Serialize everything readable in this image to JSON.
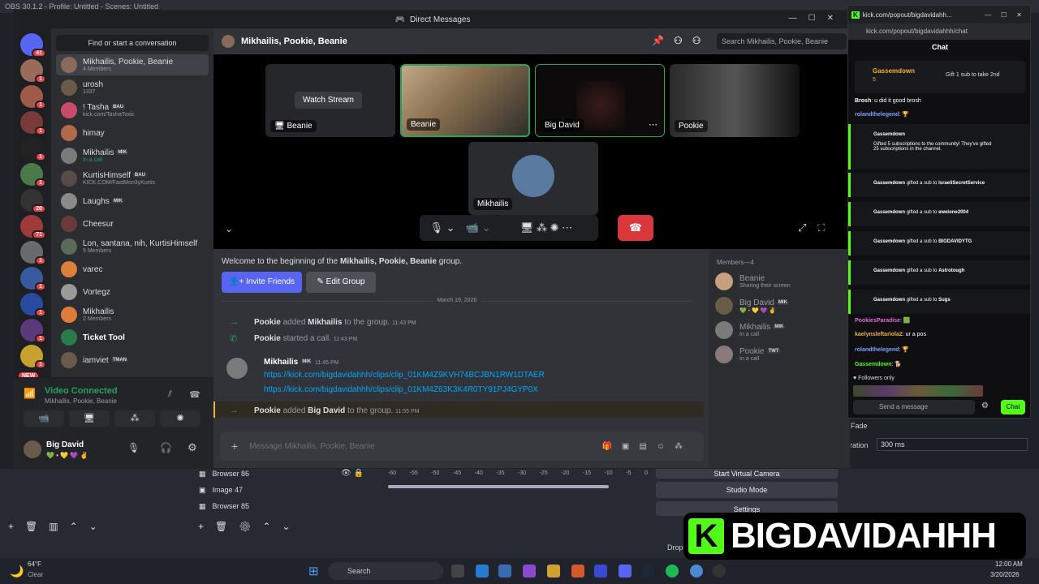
{
  "obs": {
    "title": "OBS 30.1.2 - Profile: Untitled - Scenes: Untitled",
    "sources": [
      "Browser 86",
      "Image 47",
      "Browser 85"
    ],
    "buttons": {
      "virtual_camera": "Start Virtual Camera",
      "studio_mode": "Studio Mode",
      "settings": "Settings"
    },
    "transition_label_fade": "Fade",
    "duration_label": "uration",
    "duration_value": "300 ms",
    "meter_ticks": [
      "-60",
      "-55",
      "-50",
      "-45",
      "-40",
      "-35",
      "-30",
      "-25",
      "-20",
      "-15",
      "-10",
      "-5",
      "0"
    ],
    "drop_label": "Drop"
  },
  "discord": {
    "window_title": "Direct Messages",
    "find_conversation": "Find or start a conversation",
    "server_badges": [
      "41",
      "1",
      "1",
      "1",
      "1",
      "1",
      "20",
      "71",
      "1",
      "1",
      "1",
      "1",
      "1",
      "NEW"
    ],
    "dms": [
      {
        "name": "Mikhailis, Pookie, Beanie",
        "sub": "4 Members",
        "tag": "",
        "color": "#8a6a5a"
      },
      {
        "name": "urosh",
        "sub": "1337",
        "tag": "",
        "color": "#6b5a48"
      },
      {
        "name": "! Tasha",
        "sub": "kick.com/TashaToxic",
        "tag": "BAU",
        "color": "#c94a6a"
      },
      {
        "name": "himay",
        "sub": "",
        "tag": "",
        "color": "#b06a4a"
      },
      {
        "name": "Mikhailis",
        "sub": "In a call",
        "tag": "MIK",
        "color": "#7a7a7a"
      },
      {
        "name": "KurtisHimself",
        "sub": "KICK.COM/FastMon3yKurtis",
        "tag": "BAU",
        "color": "#5a4a4a"
      },
      {
        "name": "Laughs",
        "sub": "",
        "tag": "MIK",
        "color": "#8a8a8a"
      },
      {
        "name": "Cheesur",
        "sub": "",
        "tag": "",
        "color": "#6a3a3a"
      },
      {
        "name": "Lon, santana, nih, KurtisHimself",
        "sub": "5 Members",
        "tag": "",
        "color": "#5a6a5a"
      },
      {
        "name": "varec",
        "sub": "",
        "tag": "",
        "color": "#d9803a"
      },
      {
        "name": "Vortegz",
        "sub": "",
        "tag": "",
        "color": "#9a9a9a"
      },
      {
        "name": "Mikhailis",
        "sub": "2 Members",
        "tag": "",
        "color": "#e07b39"
      },
      {
        "name": "Ticket Tool",
        "sub": "",
        "tag": "",
        "color": "#2b7a4a"
      },
      {
        "name": "iamviet",
        "sub": "",
        "tag": "TMAN",
        "color": "#6a5a4a"
      }
    ],
    "voice": {
      "status": "Video Connected",
      "channel": "Mikhailis, Pookie, Beanie"
    },
    "user": {
      "name": "Big David",
      "status_emojis": "💚 • 💛 💜 ✌"
    },
    "channel_name": "Mikhailis, Pookie, Beanie",
    "header_search": "Search Mikhailis, Pookie, Beanie",
    "call_tiles": [
      {
        "label": "Beanie",
        "extra": "Watch Stream"
      },
      {
        "label": "Beanie",
        "extra": ""
      },
      {
        "label": "Big David",
        "extra": ""
      },
      {
        "label": "Pookie",
        "extra": ""
      }
    ],
    "self_tile": "Mikhailis",
    "welcome_prefix": "Welcome to the beginning of the ",
    "welcome_group": "Mikhailis, Pookie, Beanie",
    "welcome_suffix": " group.",
    "invite_friends": "Invite Friends",
    "edit_group": "Edit Group",
    "date_divider": "March 19, 2026",
    "messages": [
      {
        "type": "system",
        "actor": "Pookie",
        "action": "added",
        "target": "Mikhailis",
        "tail": "to the group.",
        "time": "11:43 PM"
      },
      {
        "type": "call",
        "actor": "Pookie",
        "action": "started a call.",
        "time": "11:43 PM"
      },
      {
        "type": "user",
        "author": "Mikhailis",
        "tag": "MIK",
        "time": "11:45 PM",
        "links": [
          "https://kick.com/bigdavidahhh/clips/clip_01KM4Z9KVH74BCJBN1RW1DTAER",
          "https://kick.com/bigdavidahhh/clips/clip_01KM4Z63K3K4R0TY91PJ4GYP0X"
        ]
      },
      {
        "type": "system",
        "actor": "Pookie",
        "action": "added",
        "target": "Big David",
        "tail": "to the group.",
        "time": "11:55 PM"
      }
    ],
    "message_placeholder": "Message Mikhailis, Pookie, Beanie",
    "members_header": "Members—4",
    "members": [
      {
        "name": "Beanie",
        "sub": "Sharing their screen",
        "tag": "",
        "color": "#c8a080"
      },
      {
        "name": "Big David",
        "sub": "💚 • 💛 💜 ✌",
        "tag": "MIK",
        "color": "#6a5a4a"
      },
      {
        "name": "Mikhailis",
        "sub": "In a call",
        "tag": "MIK",
        "color": "#7a7a7a"
      },
      {
        "name": "Pookie",
        "sub": "In a call",
        "tag": "TWT",
        "color": "#8a7a7a"
      }
    ]
  },
  "kick": {
    "tab_title": "kick.com/popout/bigdavidahh...",
    "url": "kick.com/popout/bigdavidahhh/chat",
    "chat_title": "Chat",
    "pinned_user": "Gassemdown",
    "pinned_count": "5",
    "pinned_action": "Gift 1 sub to take 2nd",
    "top_messages": [
      {
        "user": "Brosh",
        "text": ": u did it good brosh",
        "color": "#ffffff"
      },
      {
        "user": "rolandthelegend",
        "text": ": 🏆",
        "color": "#7aa2ff"
      }
    ],
    "gift_main": {
      "user": "Gassemdown",
      "line1": "Gifted 5 subscriptions to the community! They've gifted",
      "line2": "25 subscriptions in the channel."
    },
    "gifts": [
      {
        "user": "Gassemdown",
        "action": "gifted a sub to",
        "target": "IsraeliSecretService"
      },
      {
        "user": "Gassemdown",
        "action": "gifted a sub to",
        "target": "eweione2004"
      },
      {
        "user": "Gassemdown",
        "action": "gifted a sub to",
        "target": "BIGDAVIDYTG"
      },
      {
        "user": "Gassemdown",
        "action": "gifted a sub to",
        "target": "Astrotough"
      },
      {
        "user": "Gassemdown",
        "action": "gifted a sub to",
        "target": "Sugs"
      }
    ],
    "bottom_messages": [
      {
        "user": "PookiesParadise",
        "text": ": 🟩",
        "color": "#e06ad8"
      },
      {
        "user": "kaelynsleftariola2",
        "text": ": ur a pos",
        "color": "#e8b04a"
      },
      {
        "user": "rolandthelegend",
        "text": ": 🏆",
        "color": "#7aa2ff"
      },
      {
        "user": "Gassemdown",
        "text": ": 🐕",
        "color": "#53fc18"
      }
    ],
    "followers_only": "Followers only",
    "send_placeholder": "Send a message",
    "chat_button": "Chat",
    "accent": "#53fc18"
  },
  "taskbar": {
    "weather_temp": "64°F",
    "weather_desc": "Clear",
    "search": "Search",
    "time": "12:00 AM",
    "date": "3/20/2026"
  },
  "overlay": {
    "logo_letter": "K",
    "name": "BIGDAVIDAHHH"
  }
}
